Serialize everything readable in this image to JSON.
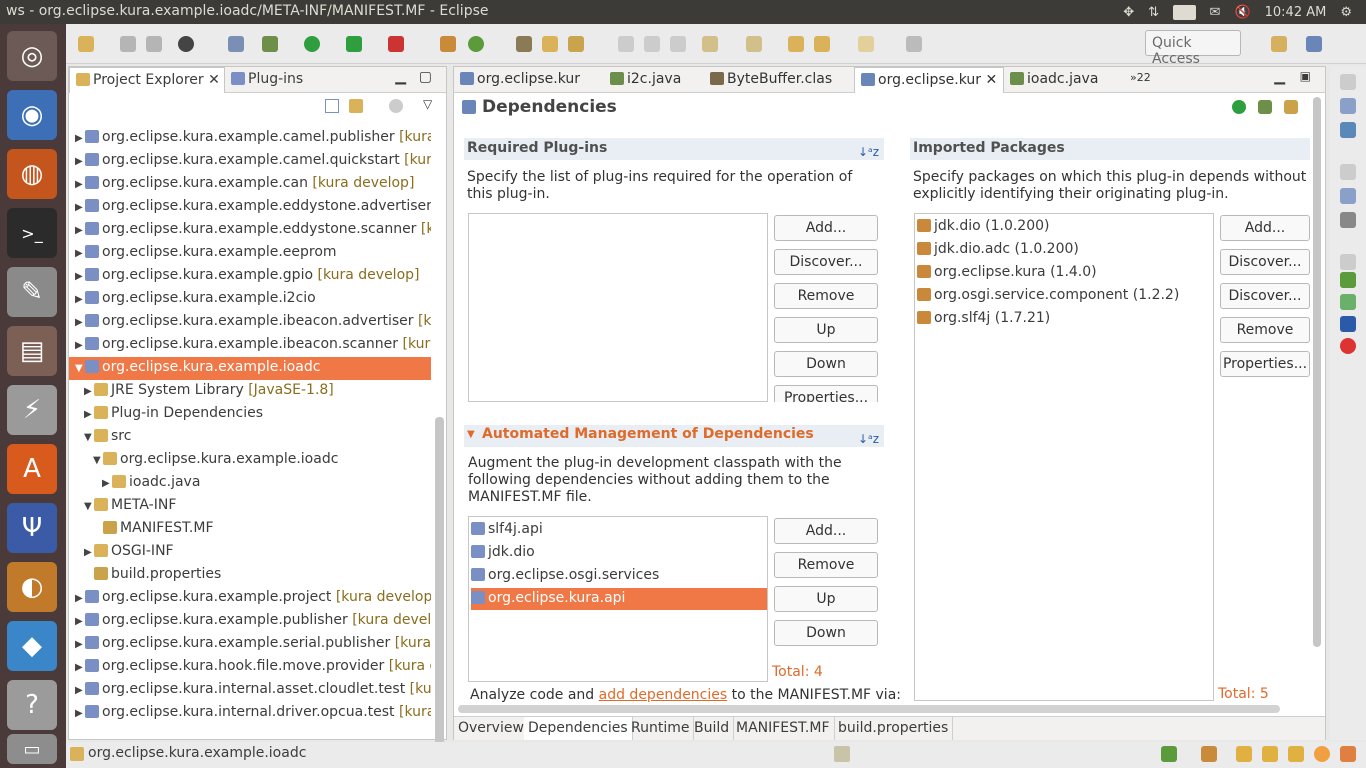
{
  "window_title": "ws - org.eclipse.kura.example.ioadc/META-INF/MANIFEST.MF - Eclipse",
  "system_tray": {
    "keyboard": "En",
    "time": "10:42 AM"
  },
  "launcher": [
    "ubuntu-logo-icon",
    "chrome-icon",
    "firefox-icon",
    "terminal-icon",
    "text-editor-icon",
    "file-manager-icon",
    "system-settings-icon",
    "software-center-icon",
    "eclipse-icon",
    "gimp-icon",
    "dropbox-icon",
    "help-icon",
    "trash-icon"
  ],
  "toolbar": {
    "quick_access": "Quick Access"
  },
  "explorer": {
    "tabs": [
      "Project Explorer",
      "Plug-ins"
    ],
    "tree": [
      {
        "label": "org.eclipse.kura.example.camel.publisher",
        "decoration": "[kura d",
        "indent": 0,
        "tw": "▶"
      },
      {
        "label": "org.eclipse.kura.example.camel.quickstart",
        "decoration": "[kura c",
        "indent": 0,
        "tw": "▶"
      },
      {
        "label": "org.eclipse.kura.example.can",
        "decoration": "[kura develop]",
        "indent": 0,
        "tw": "▶"
      },
      {
        "label": "org.eclipse.kura.example.eddystone.advertiser",
        "decoration": "[k",
        "indent": 0,
        "tw": "▶"
      },
      {
        "label": "org.eclipse.kura.example.eddystone.scanner",
        "decoration": "[kur",
        "indent": 0,
        "tw": "▶"
      },
      {
        "label": "org.eclipse.kura.example.eeprom",
        "decoration": "",
        "indent": 0,
        "tw": "▶"
      },
      {
        "label": "org.eclipse.kura.example.gpio",
        "decoration": "[kura develop]",
        "indent": 0,
        "tw": "▶"
      },
      {
        "label": "org.eclipse.kura.example.i2cio",
        "decoration": "",
        "indent": 0,
        "tw": "▶"
      },
      {
        "label": "org.eclipse.kura.example.ibeacon.advertiser",
        "decoration": "[kura",
        "indent": 0,
        "tw": "▶"
      },
      {
        "label": "org.eclipse.kura.example.ibeacon.scanner",
        "decoration": "[kura d",
        "indent": 0,
        "tw": "▶"
      },
      {
        "label": "org.eclipse.kura.example.ioadc",
        "decoration": "",
        "indent": 0,
        "tw": "▼",
        "selected": true
      },
      {
        "label": "JRE System Library",
        "decoration": "[JavaSE-1.8]",
        "indent": 1,
        "tw": "▶"
      },
      {
        "label": "Plug-in Dependencies",
        "decoration": "",
        "indent": 1,
        "tw": "▶"
      },
      {
        "label": "src",
        "decoration": "",
        "indent": 1,
        "tw": "▼"
      },
      {
        "label": "org.eclipse.kura.example.ioadc",
        "decoration": "",
        "indent": 2,
        "tw": "▼"
      },
      {
        "label": "ioadc.java",
        "decoration": "",
        "indent": 3,
        "tw": "▶"
      },
      {
        "label": "META-INF",
        "decoration": "",
        "indent": 1,
        "tw": "▼"
      },
      {
        "label": "MANIFEST.MF",
        "decoration": "",
        "indent": 2,
        "tw": ""
      },
      {
        "label": "OSGI-INF",
        "decoration": "",
        "indent": 1,
        "tw": "▶"
      },
      {
        "label": "build.properties",
        "decoration": "",
        "indent": 1,
        "tw": ""
      },
      {
        "label": "org.eclipse.kura.example.project",
        "decoration": "[kura develop]",
        "indent": 0,
        "tw": "▶"
      },
      {
        "label": "org.eclipse.kura.example.publisher",
        "decoration": "[kura develop",
        "indent": 0,
        "tw": "▶"
      },
      {
        "label": "org.eclipse.kura.example.serial.publisher",
        "decoration": "[kura de",
        "indent": 0,
        "tw": "▶"
      },
      {
        "label": "org.eclipse.kura.hook.file.move.provider",
        "decoration": "[kura de",
        "indent": 0,
        "tw": "▶"
      },
      {
        "label": "org.eclipse.kura.internal.asset.cloudlet.test",
        "decoration": "[kura",
        "indent": 0,
        "tw": "▶"
      },
      {
        "label": "org.eclipse.kura.internal.driver.opcua.test",
        "decoration": "[kura d",
        "indent": 0,
        "tw": "▶"
      }
    ]
  },
  "editor": {
    "tabs": [
      "org.eclipse.kur",
      "i2c.java",
      "ByteBuffer.clas",
      "org.eclipse.kur",
      "ioadc.java",
      "»22"
    ],
    "page_title": "Dependencies",
    "required": {
      "title": "Required Plug-ins",
      "description": "Specify the list of plug-ins required for the operation of this plug-in.",
      "buttons": [
        "Add...",
        "Discover...",
        "Remove",
        "Up",
        "Down",
        "Properties..."
      ]
    },
    "automated": {
      "title": "Automated Management of Dependencies",
      "description": "Augment the plug-in development classpath with the following dependencies without adding them to the MANIFEST.MF file.",
      "items": [
        "slf4j.api",
        "jdk.dio",
        "org.eclipse.osgi.services",
        "org.eclipse.kura.api"
      ],
      "buttons": [
        "Add...",
        "Remove",
        "Up",
        "Down"
      ],
      "total": "Total: 4",
      "analyze_prefix": "Analyze code and",
      "analyze_link": "add dependencies",
      "analyze_suffix": "to the MANIFEST.MF via:"
    },
    "imported": {
      "title": "Imported Packages",
      "description": "Specify packages on which this plug-in depends without explicitly identifying their originating plug-in.",
      "items": [
        "jdk.dio (1.0.200)",
        "jdk.dio.adc (1.0.200)",
        "org.eclipse.kura (1.4.0)",
        "org.osgi.service.component (1.2.2)",
        "org.slf4j (1.7.21)"
      ],
      "buttons": [
        "Add...",
        "Discover...",
        "Discover...",
        "Remove",
        "Properties..."
      ],
      "total": "Total: 5"
    },
    "bottom_tabs": [
      "Overview",
      "Dependencies",
      "Runtime",
      "Build",
      "MANIFEST.MF",
      "build.properties"
    ]
  },
  "status": {
    "text": "org.eclipse.kura.example.ioadc"
  },
  "colors": {
    "selection": "#f07746",
    "accent_text": "#e06a2a",
    "launcher_bg": "#4b3a3a"
  }
}
